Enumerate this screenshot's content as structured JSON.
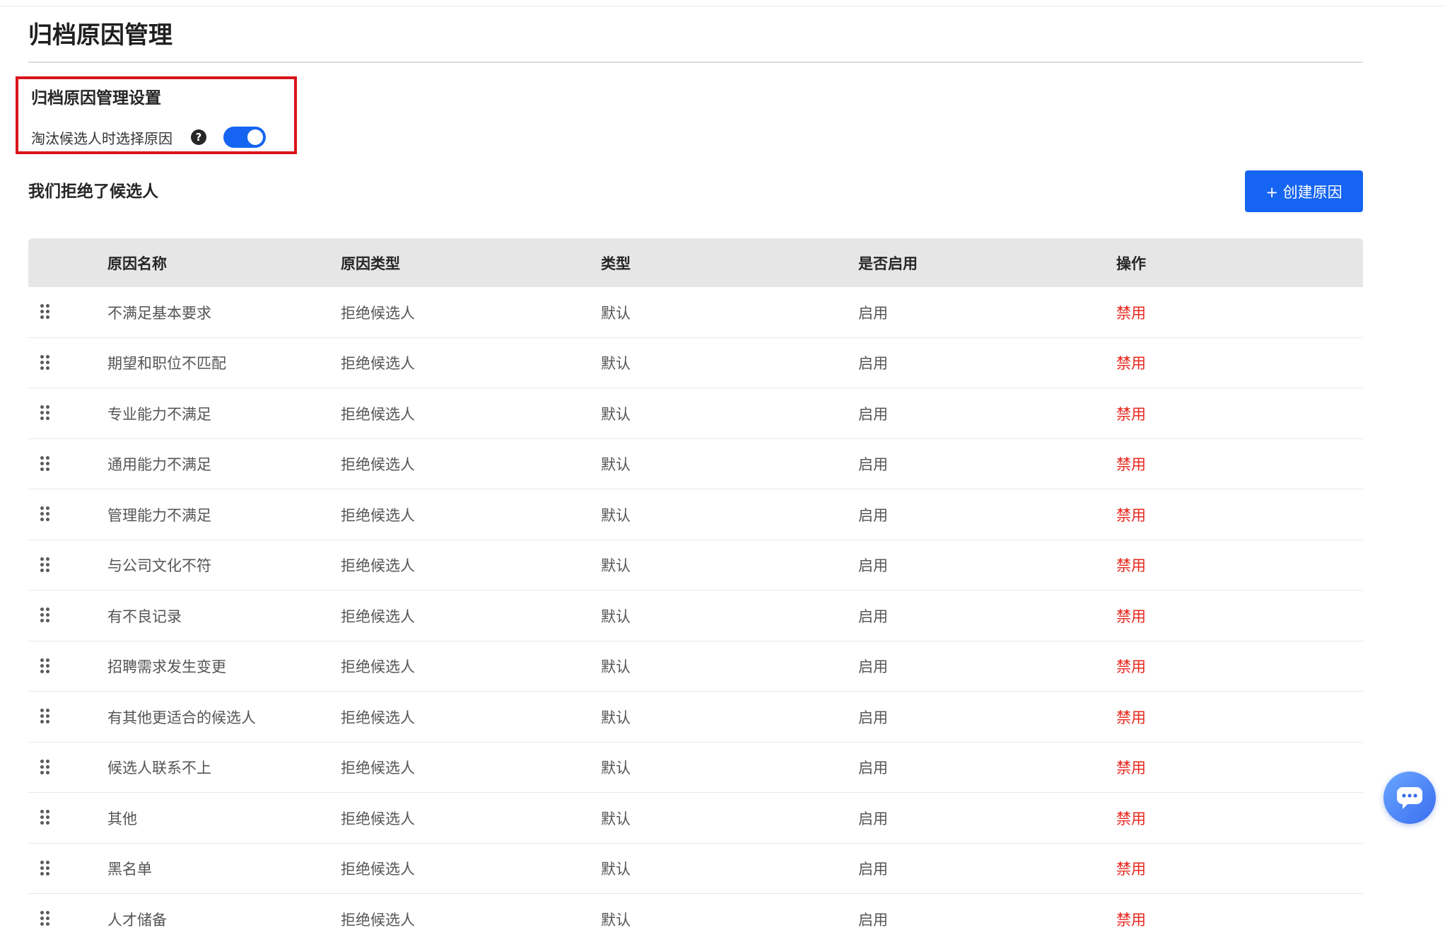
{
  "header": {
    "title": "归档原因管理"
  },
  "settings": {
    "title": "归档原因管理设置",
    "label": "淘汰候选人时选择原因",
    "help_icon": "question-circle-icon",
    "toggle_on": true
  },
  "section": {
    "title": "我们拒绝了候选人",
    "create_button": "+ 创建原因"
  },
  "table": {
    "columns": [
      "原因名称",
      "原因类型",
      "类型",
      "是否启用",
      "操作"
    ],
    "rows": [
      {
        "name": "不满足基本要求",
        "reason_type": "拒绝候选人",
        "type": "默认",
        "enabled": "启用",
        "action": "禁用"
      },
      {
        "name": "期望和职位不匹配",
        "reason_type": "拒绝候选人",
        "type": "默认",
        "enabled": "启用",
        "action": "禁用"
      },
      {
        "name": "专业能力不满足",
        "reason_type": "拒绝候选人",
        "type": "默认",
        "enabled": "启用",
        "action": "禁用"
      },
      {
        "name": "通用能力不满足",
        "reason_type": "拒绝候选人",
        "type": "默认",
        "enabled": "启用",
        "action": "禁用"
      },
      {
        "name": "管理能力不满足",
        "reason_type": "拒绝候选人",
        "type": "默认",
        "enabled": "启用",
        "action": "禁用"
      },
      {
        "name": "与公司文化不符",
        "reason_type": "拒绝候选人",
        "type": "默认",
        "enabled": "启用",
        "action": "禁用"
      },
      {
        "name": "有不良记录",
        "reason_type": "拒绝候选人",
        "type": "默认",
        "enabled": "启用",
        "action": "禁用"
      },
      {
        "name": "招聘需求发生变更",
        "reason_type": "拒绝候选人",
        "type": "默认",
        "enabled": "启用",
        "action": "禁用"
      },
      {
        "name": "有其他更适合的候选人",
        "reason_type": "拒绝候选人",
        "type": "默认",
        "enabled": "启用",
        "action": "禁用"
      },
      {
        "name": "候选人联系不上",
        "reason_type": "拒绝候选人",
        "type": "默认",
        "enabled": "启用",
        "action": "禁用"
      },
      {
        "name": "其他",
        "reason_type": "拒绝候选人",
        "type": "默认",
        "enabled": "启用",
        "action": "禁用"
      },
      {
        "name": "黑名单",
        "reason_type": "拒绝候选人",
        "type": "默认",
        "enabled": "启用",
        "action": "禁用"
      },
      {
        "name": "人才储备",
        "reason_type": "拒绝候选人",
        "type": "默认",
        "enabled": "启用",
        "action": "禁用"
      }
    ]
  },
  "colors": {
    "primary": "#1665f2",
    "danger": "#e8271e",
    "highlight_border": "#d9141b"
  },
  "icons": {
    "drag_handle": "drag-handle-icon",
    "chat": "chat-bubble-icon"
  }
}
